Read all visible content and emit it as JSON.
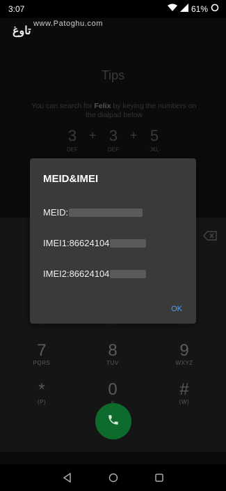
{
  "status": {
    "time": "3:07",
    "battery": "61%"
  },
  "watermark": {
    "logo": "تاوغ",
    "url": "www.Patoghu.com"
  },
  "tips": {
    "title": "Tips",
    "desc_prefix": "You can search for ",
    "desc_name": "Felix",
    "desc_suffix": " by keying the numbers on the dialpad below"
  },
  "sequence": [
    {
      "num": "3",
      "letters": "DEF"
    },
    {
      "num": "3",
      "letters": "DEF"
    },
    {
      "num": "5",
      "letters": "JKL"
    }
  ],
  "sequence_plus": "+",
  "keys": [
    {
      "digit": "7",
      "letters": "PQRS"
    },
    {
      "digit": "8",
      "letters": "TUV"
    },
    {
      "digit": "9",
      "letters": "WXYZ"
    },
    {
      "digit": "*",
      "letters": "(P)"
    },
    {
      "digit": "0",
      "letters": "+"
    },
    {
      "digit": "#",
      "letters": "(W)"
    }
  ],
  "faint_row": [
    "GHI",
    "JKL",
    "MNO"
  ],
  "dialog": {
    "title": "MEID&IMEI",
    "meid_label": "MEID:",
    "imei1_label": "IMEI1:86624104",
    "imei2_label": "IMEI2:86624104",
    "ok_label": "OK"
  },
  "icons": {
    "wifi": "wifi-icon",
    "signal": "signal-icon",
    "battery": "battery-icon",
    "backspace": "backspace-icon",
    "call": "phone-icon",
    "back": "back-icon",
    "home": "home-icon",
    "recents": "recents-icon"
  },
  "colors": {
    "call_button": "#0e6b2e",
    "ok_link": "#4aa3ff",
    "dialog_bg": "#3a3a3a"
  }
}
